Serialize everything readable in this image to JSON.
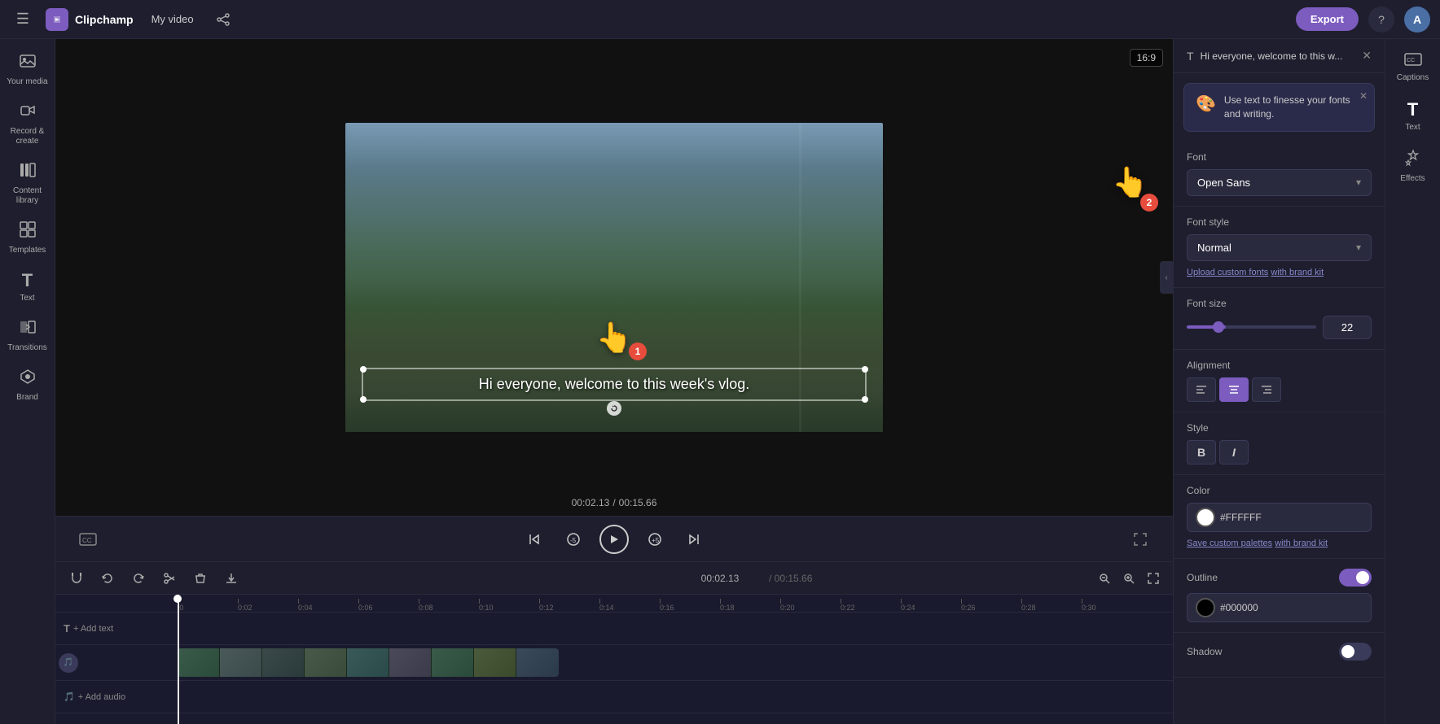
{
  "app": {
    "name": "Clipchamp",
    "title": "My video",
    "export_label": "Export",
    "avatar_letter": "A"
  },
  "topbar": {
    "menu_icon": "☰",
    "upload_icon": "⬆",
    "help_icon": "?",
    "share_icon": "🔗"
  },
  "left_sidebar": {
    "items": [
      {
        "id": "your-media",
        "icon": "🖼",
        "label": "Your media"
      },
      {
        "id": "record-create",
        "icon": "⏺",
        "label": "Record & create"
      },
      {
        "id": "content-library",
        "icon": "📚",
        "label": "Content library"
      },
      {
        "id": "templates",
        "icon": "▦",
        "label": "Templates"
      },
      {
        "id": "text",
        "icon": "T",
        "label": "Text"
      },
      {
        "id": "transitions",
        "icon": "⬡",
        "label": "Transitions"
      },
      {
        "id": "brand-kit",
        "icon": "◈",
        "label": "Brand"
      }
    ]
  },
  "preview": {
    "aspect_ratio": "16:9",
    "text_overlay": "Hi everyone, welcome to this week's vlog.",
    "cursor_1_badge": "1",
    "cursor_2_badge": "2"
  },
  "playback": {
    "time_current": "00:02.13",
    "time_total": "00:15.66",
    "cc_label": "CC"
  },
  "timeline": {
    "tools": [
      "🧲",
      "↩",
      "↪",
      "✂",
      "🗑",
      "⬇"
    ],
    "zoom_in": "+",
    "zoom_out": "−",
    "expand": "⤢",
    "playhead_time": "00:02.13",
    "ruler_marks": [
      "0",
      "0:02",
      "0:04",
      "0:06",
      "0:08",
      "0:10",
      "0:12",
      "0:14",
      "0:16",
      "0:18",
      "0:20",
      "0:22",
      "0:24",
      "0:26",
      "0:28",
      "0:30"
    ],
    "text_track_label": "T + Add text",
    "audio_track_label": "🎵 + Add audio"
  },
  "right_panel": {
    "header_text": "Hi everyone, welcome to this w...",
    "close_icon": "✕",
    "tip": {
      "emoji": "🎨",
      "text": "Use text to finesse your fonts and writing.",
      "close_icon": "✕"
    },
    "font_label": "Font",
    "font_value": "Open Sans",
    "font_style_label": "Font style",
    "font_style_value": "Normal",
    "upload_link_text": "Upload custom fonts",
    "upload_link_suffix": "with brand kit",
    "font_size_label": "Font size",
    "font_size_value": "22",
    "alignment_label": "Alignment",
    "alignments": [
      "left",
      "center",
      "right"
    ],
    "active_alignment": "center",
    "style_label": "Style",
    "bold_label": "B",
    "italic_label": "I",
    "color_label": "Color",
    "color_hex": "#FFFFFF",
    "color_swatch": "#FFFFFF",
    "save_palettes_text": "Save custom palettes",
    "save_palettes_suffix": "with brand kit",
    "outline_label": "Outline",
    "outline_enabled": true,
    "outline_color": "#000000",
    "outline_hex": "#000000",
    "shadow_label": "Shadow",
    "shadow_enabled": false
  },
  "mini_sidebar": {
    "items": [
      {
        "id": "captions",
        "icon": "⊡",
        "label": "Captions"
      },
      {
        "id": "text",
        "icon": "T",
        "label": "Text"
      },
      {
        "id": "effects",
        "icon": "✦",
        "label": "Effects"
      }
    ]
  }
}
